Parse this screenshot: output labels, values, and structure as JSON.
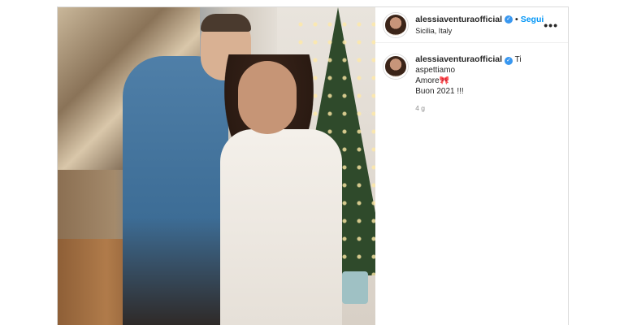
{
  "post": {
    "username": "alessiaventuraofficial",
    "follow_label": "Segui",
    "separator": "•",
    "location": "Sicilia, Italy",
    "more_label": "•••"
  },
  "caption": {
    "username": "alessiaventuraofficial",
    "line1": "Ti aspettiamo",
    "line2": "Amore",
    "emoji": "🎀",
    "line3": "Buon 2021 !!!",
    "time": "4 g"
  },
  "colors": {
    "accent": "#0095f6",
    "verified": "#3897f0",
    "muted": "#8e8e8e"
  },
  "icons": {
    "verified": "verified-badge-icon",
    "more": "more-options-icon"
  }
}
